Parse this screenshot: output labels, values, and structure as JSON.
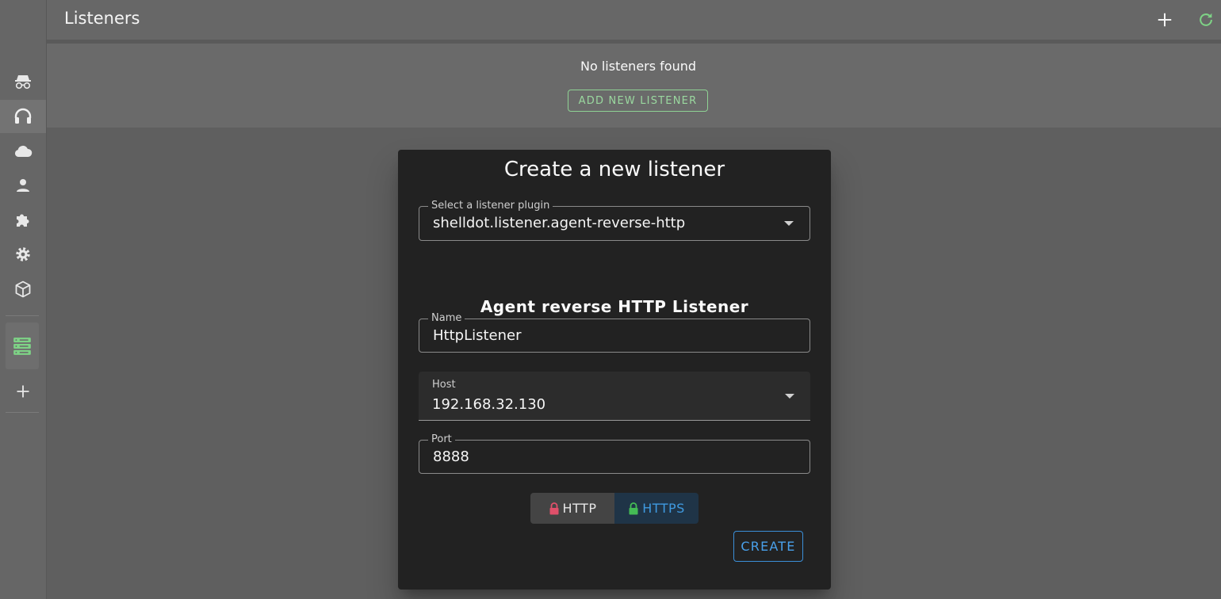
{
  "header": {
    "title": "Listeners",
    "add_icon": "plus-icon",
    "refresh_icon": "refresh-icon"
  },
  "sidebar": {
    "items": [
      {
        "icon": "incognito-icon",
        "active": false
      },
      {
        "icon": "headphones-icon",
        "active": true
      },
      {
        "icon": "cloud-icon",
        "active": false
      },
      {
        "icon": "user-icon",
        "active": false
      },
      {
        "icon": "puzzle-icon",
        "active": false
      },
      {
        "icon": "gear-icon",
        "active": false
      },
      {
        "icon": "package-icon",
        "active": false
      },
      {
        "icon": "server-icon",
        "active": false
      },
      {
        "icon": "plus-icon",
        "active": false
      }
    ],
    "server_color": "#7ed386"
  },
  "empty_state": {
    "message": "No listeners found",
    "button_label": "ADD NEW LISTENER"
  },
  "dialog": {
    "title": "Create a new listener",
    "plugin": {
      "label": "Select a listener plugin",
      "value": "shelldot.listener.agent-reverse-http"
    },
    "section_title": "Agent reverse HTTP Listener",
    "name": {
      "label": "Name",
      "value": "HttpListener"
    },
    "host": {
      "label": "Host",
      "value": "192.168.32.130"
    },
    "port": {
      "label": "Port",
      "value": "8888"
    },
    "protocol": {
      "options": [
        "HTTP",
        "HTTPS"
      ],
      "selected": "HTTPS",
      "http_lock_color": "#e0506a",
      "https_lock_color": "#44bb55"
    },
    "create_label": "CREATE"
  },
  "colors": {
    "accent_green": "#8fd294",
    "accent_blue": "#3b8fd8"
  }
}
